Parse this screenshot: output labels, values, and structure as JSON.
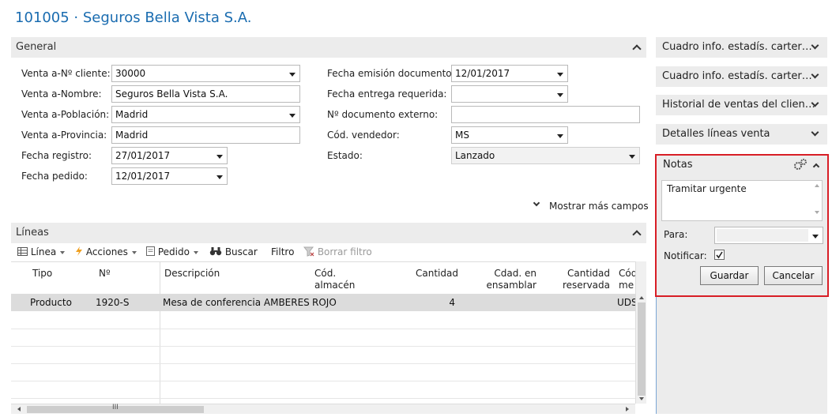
{
  "window": {
    "title": "101005 · Seguros Bella Vista S.A."
  },
  "general": {
    "header": "General",
    "fields": {
      "cliente_label": "Venta a-Nº cliente:",
      "cliente_value": "30000",
      "nombre_label": "Venta a-Nombre:",
      "nombre_value": "Seguros Bella Vista S.A.",
      "poblacion_label": "Venta a-Población:",
      "poblacion_value": "Madrid",
      "provincia_label": "Venta a-Provincia:",
      "provincia_value": "Madrid",
      "fecha_registro_label": "Fecha registro:",
      "fecha_registro_value": "27/01/2017",
      "fecha_pedido_label": "Fecha pedido:",
      "fecha_pedido_value": "12/01/2017",
      "fecha_emision_label": "Fecha emisión documento:",
      "fecha_emision_value": "12/01/2017",
      "fecha_entrega_label": "Fecha entrega requerida:",
      "fecha_entrega_value": "",
      "doc_externo_label": "Nº documento externo:",
      "doc_externo_value": "",
      "vendedor_label": "Cód. vendedor:",
      "vendedor_value": "MS",
      "estado_label": "Estado:",
      "estado_value": "Lanzado"
    },
    "show_more": "Mostrar más campos"
  },
  "lineas": {
    "header": "Líneas",
    "toolbar": {
      "linea": "Línea",
      "acciones": "Acciones",
      "pedido": "Pedido",
      "buscar": "Buscar",
      "filtro": "Filtro",
      "borrar_filtro": "Borrar filtro"
    },
    "columns": {
      "tipo": "Tipo",
      "no": "Nº",
      "descripcion": "Descripción",
      "almacen_1": "Cód.",
      "almacen_2": "almacén",
      "cantidad": "Cantidad",
      "ensamblar_1": "Cdad. en",
      "ensamblar_2": "ensamblar par…",
      "reservada_1": "Cantidad",
      "reservada_2": "reservada",
      "unidad_1": "Cód",
      "unidad_2": "me"
    },
    "rows": [
      {
        "tipo": "Producto",
        "no": "1920-S",
        "descripcion": "Mesa de conferencia AMBERES",
        "almacen": "ROJO",
        "cantidad": "4",
        "unidad": "UDS"
      }
    ],
    "hscroll_glyph": "III"
  },
  "factboxes": [
    {
      "label": "Cuadro info. estadís. carter…"
    },
    {
      "label": "Cuadro info. estadís. carter…"
    },
    {
      "label": "Historial de ventas del clien…"
    },
    {
      "label": "Detalles líneas venta"
    }
  ],
  "notas": {
    "header": "Notas",
    "text": "Tramitar urgente",
    "para_label": "Para:",
    "para_value": "",
    "notificar_label": "Notificar:",
    "notificar_checked": true,
    "guardar": "Guardar",
    "cancelar": "Cancelar"
  }
}
